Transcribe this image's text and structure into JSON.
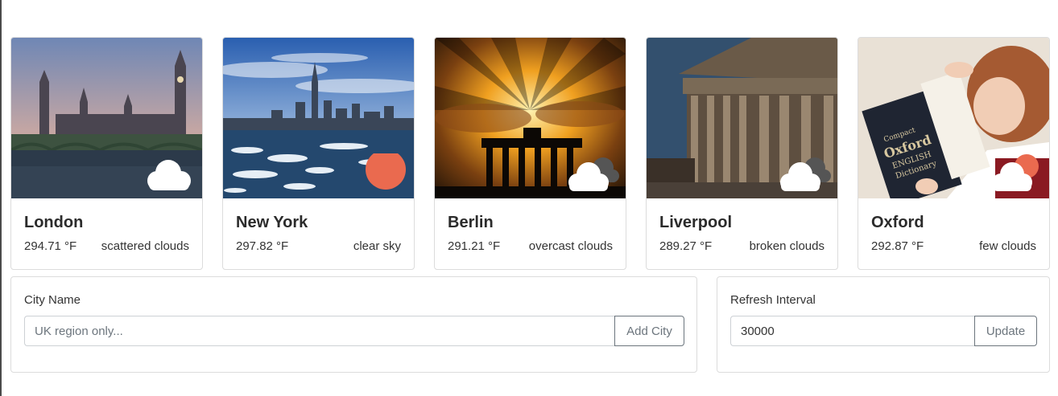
{
  "cards": [
    {
      "city": "London",
      "temp": "294.71 °F",
      "desc": "scattered clouds",
      "image": "london-bridge-photo",
      "icon": "scattered-clouds-icon"
    },
    {
      "city": "New York",
      "temp": "297.82 °F",
      "desc": "clear sky",
      "image": "new-york-skyline-photo",
      "icon": "sun-icon"
    },
    {
      "city": "Berlin",
      "temp": "291.21 °F",
      "desc": "overcast clouds",
      "image": "brandenburg-gate-photo",
      "icon": "overcast-clouds-icon"
    },
    {
      "city": "Liverpool",
      "temp": "289.27 °F",
      "desc": "broken clouds",
      "image": "st-georges-hall-photo",
      "icon": "broken-clouds-icon"
    },
    {
      "city": "Oxford",
      "temp": "292.87 °F",
      "desc": "few clouds",
      "image": "child-reading-dictionary-photo",
      "icon": "few-clouds-icon"
    }
  ],
  "city_form": {
    "label": "City Name",
    "placeholder": "UK region only...",
    "value": "",
    "button": "Add City"
  },
  "refresh_form": {
    "label": "Refresh Interval",
    "value": "30000",
    "button": "Update"
  },
  "colors": {
    "sun": "#ea6a4f",
    "cloud": "#ffffff",
    "dark_cloud": "#555555",
    "border": "#dcdcdc"
  }
}
